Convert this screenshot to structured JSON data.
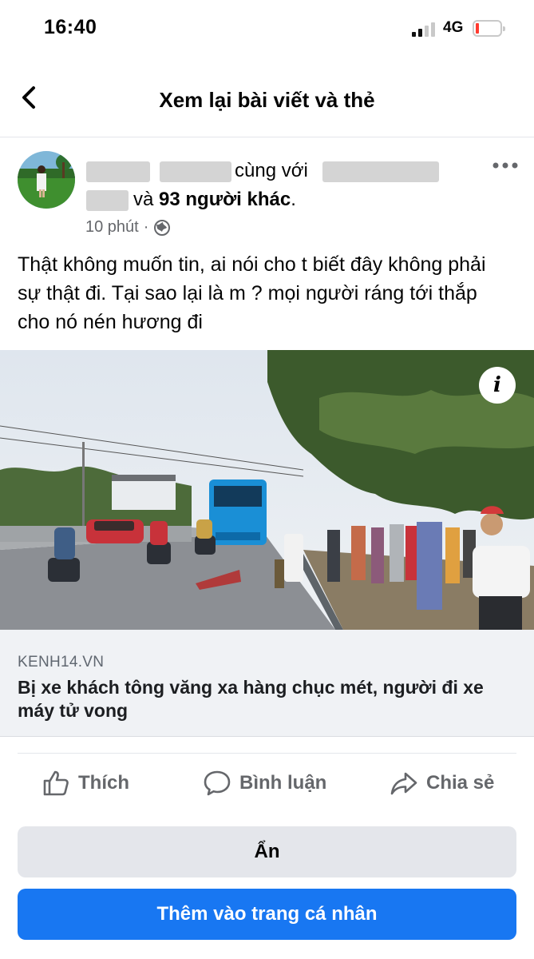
{
  "status_bar": {
    "time": "16:40",
    "network": "4G"
  },
  "header": {
    "title": "Xem lại bài viết và thẻ"
  },
  "post": {
    "with_text": "cùng với",
    "and_text": "và",
    "others": "93 người khác",
    "period": ".",
    "time": "10 phút",
    "separator": "·",
    "text": "Thật không muốn tin, ai nói cho t biết đây không phải sự thật đi. Tại sao lại là m ? mọi người ráng tới thắp cho nó nén hương đi"
  },
  "link": {
    "domain": "KENH14.VN",
    "title": "Bị xe khách tông văng xa hàng chục mét, người đi xe máy tử vong"
  },
  "actions": {
    "like": "Thích",
    "comment": "Bình luận",
    "share": "Chia sẻ"
  },
  "buttons": {
    "hide": "Ẩn",
    "add": "Thêm vào trang cá nhân"
  },
  "colors": {
    "primary": "#1877f2",
    "secondary_button": "#e4e6eb",
    "link_card_bg": "#f0f2f5",
    "meta_text": "#65676b"
  },
  "icons": [
    "back-icon",
    "globe-icon",
    "more-icon",
    "info-icon",
    "like-icon",
    "comment-icon",
    "share-icon"
  ]
}
